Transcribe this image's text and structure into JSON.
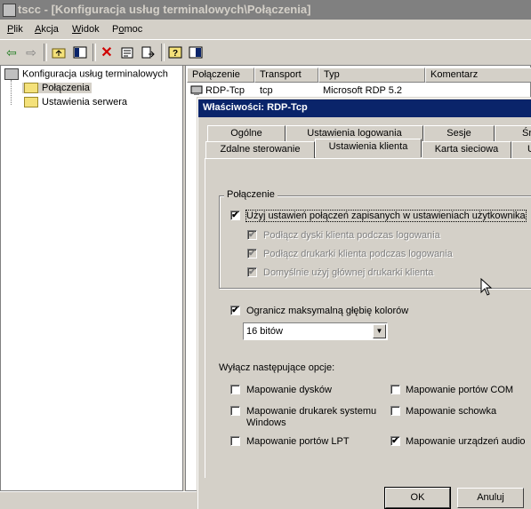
{
  "window": {
    "title": "tscc - [Konfiguracja usług terminalowych\\Połączenia]"
  },
  "menu": [
    {
      "label": "Plik",
      "u": "P"
    },
    {
      "label": "Akcja",
      "u": "A"
    },
    {
      "label": "Widok",
      "u": "W"
    },
    {
      "label": "Pomoc",
      "u": "o"
    }
  ],
  "toolbar": [
    "back-icon",
    "forward-icon",
    "up-folder-icon",
    "show-hide-tree-icon",
    "delete-icon",
    "properties-icon",
    "export-list-icon",
    "help-icon",
    "action-pane-icon"
  ],
  "tree": {
    "root": "Konfiguracja usług terminalowych",
    "children": [
      "Połączenia",
      "Ustawienia serwera"
    ],
    "selected": "Połączenia"
  },
  "list": {
    "columns": [
      "Połączenie",
      "Transport",
      "Typ",
      "Komentarz"
    ],
    "rows": [
      [
        "RDP-Tcp",
        "tcp",
        "Microsoft RDP 5.2",
        ""
      ]
    ]
  },
  "dialog": {
    "title": "Właściwości: RDP-Tcp",
    "tabs_row1": [
      "Ogólne",
      "Ustawienia logowania",
      "Sesje",
      "Śr"
    ],
    "tabs_row2": [
      "Zdalne sterowanie",
      "Ustawienia klienta",
      "Karta sieciowa",
      "U"
    ],
    "active_tab": "Ustawienia klienta",
    "group_title": "Połączenie",
    "use_conn_settings": "Użyj ustawień połączeń zapisanych w ustawieniach użytkownika",
    "connect_drives": "Podłącz dyski klienta podczas logowania",
    "connect_printers": "Podłącz drukarki klienta podczas logowania",
    "default_printer": "Domyślnie użyj głównej drukarki klienta",
    "limit_color": "Ogranicz maksymalną głębię kolorów",
    "color_depth": "16 bitów",
    "disable_label": "Wyłącz następujące opcje:",
    "options": {
      "drives": "Mapowanie dysków",
      "com": "Mapowanie portów COM",
      "printers_1": "Mapowanie drukarek systemu",
      "printers_2": "Windows",
      "clipboard": "Mapowanie schowka",
      "lpt": "Mapowanie portów LPT",
      "audio": "Mapowanie urządzeń audio"
    },
    "check": "✔",
    "ok": "OK",
    "cancel": "Anuluj"
  }
}
